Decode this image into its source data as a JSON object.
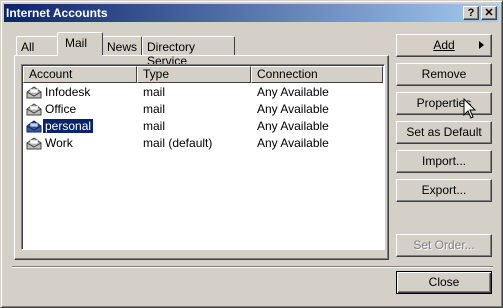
{
  "window": {
    "title": "Internet Accounts",
    "help_glyph": "?",
    "close_glyph": "✕"
  },
  "tabs": [
    {
      "label": "All"
    },
    {
      "label": "Mail"
    },
    {
      "label": "News"
    },
    {
      "label": "Directory Service"
    }
  ],
  "list": {
    "columns": [
      "Account",
      "Type",
      "Connection"
    ],
    "rows": [
      {
        "account": "Infodesk",
        "type": "mail",
        "connection": "Any Available"
      },
      {
        "account": "Office",
        "type": "mail",
        "connection": "Any Available"
      },
      {
        "account": "personal",
        "type": "mail",
        "connection": "Any Available"
      },
      {
        "account": "Work",
        "type": "mail (default)",
        "connection": "Any Available"
      }
    ],
    "selected": "personal"
  },
  "buttons": {
    "add": "Add",
    "remove": "Remove",
    "properties": "Properties",
    "set_default": "Set as Default",
    "import": "Import...",
    "export": "Export...",
    "set_order": "Set Order...",
    "close": "Close"
  },
  "colors": {
    "titlebar": "#0a246a",
    "selection": "#0a246a",
    "face": "#d4d0c8"
  }
}
